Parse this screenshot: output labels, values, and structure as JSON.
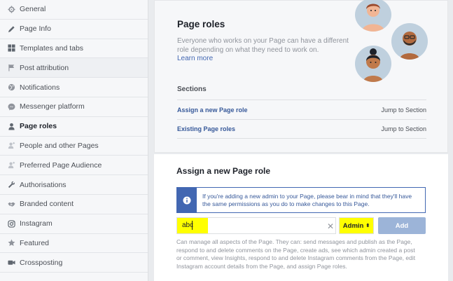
{
  "sidebar": {
    "items": [
      {
        "label": "General",
        "icon": "gear-icon"
      },
      {
        "label": "Page Info",
        "icon": "pencil-icon"
      },
      {
        "label": "Templates and tabs",
        "icon": "grid-icon"
      },
      {
        "label": "Post attribution",
        "icon": "flag-icon"
      },
      {
        "label": "Notifications",
        "icon": "globe-icon"
      },
      {
        "label": "Messenger platform",
        "icon": "messenger-icon"
      },
      {
        "label": "Page roles",
        "icon": "person-icon"
      },
      {
        "label": "People and other Pages",
        "icon": "person-plus-icon"
      },
      {
        "label": "Preferred Page Audience",
        "icon": "person-plus-icon"
      },
      {
        "label": "Authorisations",
        "icon": "wrench-icon"
      },
      {
        "label": "Branded content",
        "icon": "handshake-icon"
      },
      {
        "label": "Instagram",
        "icon": "instagram-icon"
      },
      {
        "label": "Featured",
        "icon": "star-icon"
      },
      {
        "label": "Crossposting",
        "icon": "video-icon"
      }
    ]
  },
  "page_roles": {
    "title": "Page roles",
    "description": "Everyone who works on your Page can have a different role depending on what they need to work on.",
    "learn_more": "Learn more",
    "sections_label": "Sections",
    "sections": [
      {
        "label": "Assign a new Page role",
        "jump": "Jump to Section"
      },
      {
        "label": "Existing Page roles",
        "jump": "Jump to Section"
      }
    ]
  },
  "assign": {
    "title": "Assign a new Page role",
    "info": "If you're adding a new admin to your Page, please bear in mind that they'll have the same permissions as you do to make changes to this Page.",
    "input_value": "abc",
    "role_selected": "Admin",
    "add_label": "Add",
    "role_description": "Can manage all aspects of the Page. They can: send messages and publish as the Page, respond to and delete comments on the Page, create ads, see which admin created a post or comment, view Insights, respond to and delete Instagram comments from the Page, edit Instagram account details from the Page, and assign Page roles."
  },
  "colors": {
    "accent": "#4267b2",
    "highlight": "#ffff00",
    "link": "#365899"
  }
}
